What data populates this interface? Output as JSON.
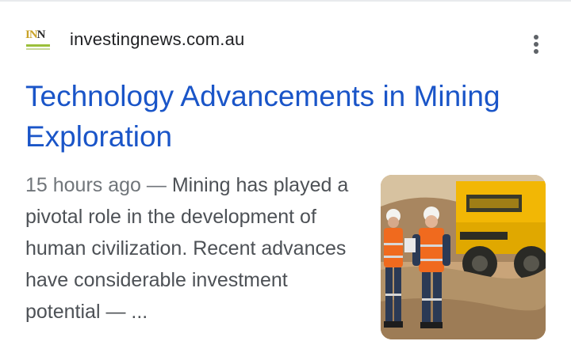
{
  "result": {
    "favicon": {
      "icon": "inn-logo-icon",
      "text": "INN",
      "colors": {
        "primary": "#c9a227",
        "secondary": "#9bbf3a"
      }
    },
    "source": "investingnews.com.au",
    "title": "Technology Advancements in Mining Exploration",
    "time": "15 hours ago",
    "separator": " — ",
    "snippet": "Mining has played a pivotal role in the development of human civilization. Recent advances have considerable investment potential — ...",
    "more_icon": "more-vert-icon",
    "thumbnail": {
      "icon": "mining-workers-photo",
      "description_colors": {
        "truck": "#f2b705",
        "vest": "#f06a1e",
        "ground": "#b29268"
      }
    },
    "colors": {
      "title": "#1a55c8",
      "text": "#4d5156",
      "time": "#70757a"
    }
  }
}
